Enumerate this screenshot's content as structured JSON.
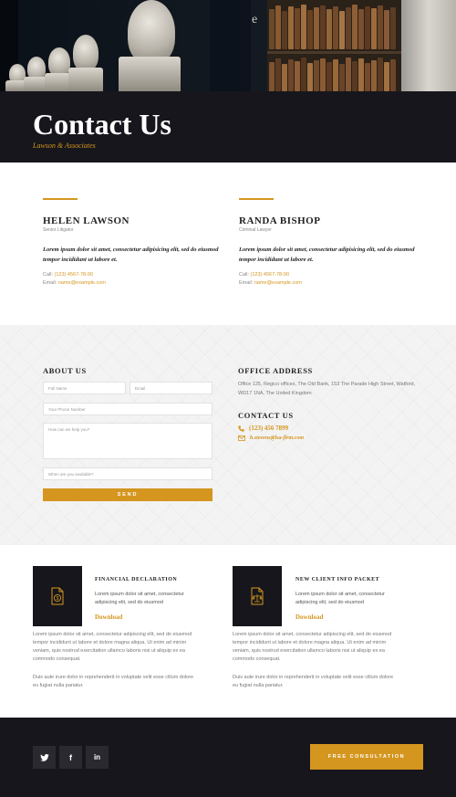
{
  "hero": {
    "title": "Contact Us",
    "subtitle": "Lawson & Associates",
    "glyph": "e"
  },
  "team": [
    {
      "name": "HELEN LAWSON",
      "role": "Senior Litigator",
      "bio": "Lorem ipsum dolor sit amet, consectetur adipisicing elit, sed do eiusmod tempor incididunt ut labore et.",
      "call_label": "Call:",
      "phone": "(123) 4567-78-90",
      "email_label": "Email:",
      "email": "name@example.com"
    },
    {
      "name": "RANDA BISHOP",
      "role": "Criminal Lawyer",
      "bio": "Lorem ipsum dolor sit amet, consectetur adipisicing elit, sed do eiusmod tempor incididunt ut labore et.",
      "call_label": "Call:",
      "phone": "(123) 4567-78-90",
      "email_label": "Email:",
      "email": "name@example.com"
    }
  ],
  "about": {
    "heading": "ABOUT US",
    "full_name_placeholder": "Full Name",
    "email_placeholder": "Email",
    "phone_placeholder": "Your Phone Number",
    "message_placeholder": "How can we help you?",
    "availability_placeholder": "When are you available?",
    "send_label": "SEND"
  },
  "office": {
    "heading": "OFFICE ADDRESS",
    "address": "Office 125, Regico offices, The Old Bank, 153 The Parade High Street, Watford, WD17 1NA, The United Kingdom",
    "contact_heading": "CONTACT US",
    "phone": "(123) 456 7899",
    "email": "h.stevens@lsa-firm.com"
  },
  "downloads": [
    {
      "icon": "document-dollar-icon",
      "title": "FINANCIAL DECLARATION",
      "desc": "Lorem ipsum dolor sit amet, consectetur adipiscing elit, sed do eiusmod",
      "link": "Download",
      "para1": "Lorem ipsum dolor sit amet, consectetur adipiscing elit, sed do eiusmod tempor incididunt ut labore et dolore magna aliqua. Ut enim ad minim veniam, quis nostrud exercitation ullamco laboris nisi ut aliquip ex ea commodo consequat.",
      "para2": "Duis aute irure dolor in reprehenderit in voluptate velit esse cillum dolore eu fugiat nulla pariatur."
    },
    {
      "icon": "document-scales-icon",
      "title": "NEW CLIENT INFO PACKET",
      "desc": "Lorem ipsum dolor sit amet, consectetur adipiscing elit, sed do eiusmod",
      "link": "Download",
      "para1": "Lorem ipsum dolor sit amet, consectetur adipiscing elit, sed do eiusmod tempor incididunt ut labore et dolore magna aliqua. Ut enim ad minim veniam, quis nostrud exercitation ullamco laboris nisi ut aliquip ex ea commodo consequat.",
      "para2": "Duis aute irure dolor in reprehenderit in voluptate velit esse cillum dolore eu fugiat nulla pariatur."
    }
  ],
  "footer": {
    "social": [
      {
        "icon": "twitter-icon",
        "glyph": "🐦"
      },
      {
        "icon": "facebook-icon",
        "glyph": "f"
      },
      {
        "icon": "linkedin-icon",
        "glyph": "in"
      }
    ],
    "cta_label": "FREE CONSULTATION"
  },
  "colors": {
    "accent": "#d4961f",
    "dark": "#17161c",
    "light_bg": "#f3f3f3"
  }
}
